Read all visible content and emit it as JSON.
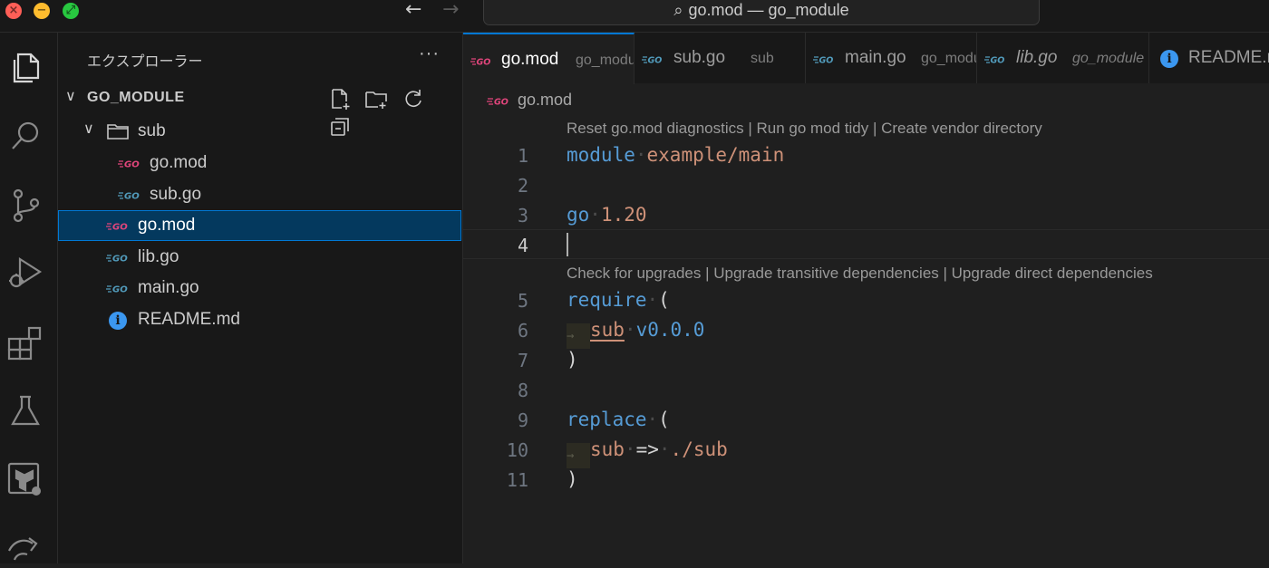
{
  "window": {
    "title": "go.mod — go_module"
  },
  "activity_bar": {
    "icons": [
      "files-icon",
      "search-icon",
      "source-control-icon",
      "run-debug-icon",
      "extensions-icon",
      "testing-icon",
      "terraform-icon",
      "remote-icon"
    ]
  },
  "sidebar": {
    "title": "エクスプローラー",
    "more": "···",
    "section": "GO_MODULE",
    "tree": [
      {
        "label": "sub",
        "type": "folder"
      },
      {
        "label": "go.mod",
        "type": "gomod"
      },
      {
        "label": "sub.go",
        "type": "go"
      },
      {
        "label": "go.mod",
        "type": "gomod",
        "selected": true
      },
      {
        "label": "lib.go",
        "type": "go"
      },
      {
        "label": "main.go",
        "type": "go"
      },
      {
        "label": "README.md",
        "type": "info"
      }
    ]
  },
  "tabs": [
    {
      "name": "go.mod",
      "desc": "go_module",
      "active": true
    },
    {
      "name": "sub.go",
      "desc": "sub"
    },
    {
      "name": "main.go",
      "desc": "go_module"
    },
    {
      "name": "lib.go",
      "desc": "go_module",
      "italic": true
    },
    {
      "name": "README.md",
      "desc": ""
    }
  ],
  "breadcrumb": "go.mod",
  "codelens": {
    "top": "Reset go.mod diagnostics | Run go mod tidy | Create vendor directory",
    "require": "Check for upgrades | Upgrade transitive dependencies | Upgrade direct dependencies"
  },
  "code": {
    "line_numbers": [
      "1",
      "2",
      "3",
      "4",
      "5",
      "6",
      "7",
      "8",
      "9",
      "10",
      "11"
    ],
    "l1_kw": "module",
    "l1_val": "example/main",
    "l3_kw": "go",
    "l3_val": "1.20",
    "l5_kw": "require",
    "l5_paren": "(",
    "l6_mod": "sub",
    "l6_ver": "v0.0.0",
    "l7": ")",
    "l9_kw": "replace",
    "l9_paren": "(",
    "l10_mod": "sub",
    "l10_arrow": "=>",
    "l10_path": "./sub",
    "l11": ")"
  },
  "colors": {
    "keyword": "#569cd6",
    "string": "#ce9178",
    "gomod_icon": "#e0457b",
    "go_icon": "#519aba",
    "accent": "#0078d4"
  }
}
